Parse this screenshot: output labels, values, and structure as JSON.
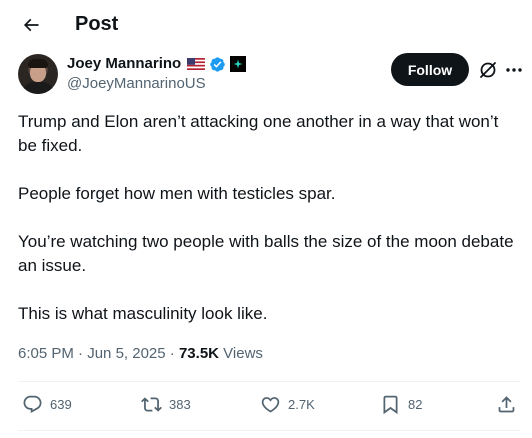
{
  "header": {
    "title": "Post"
  },
  "author": {
    "display_name": "Joey Mannarino",
    "handle": "@JoeyMannarinoUS",
    "flag": "us-flag",
    "verified": "blue-verified-badge",
    "affiliation": "affiliate-badge"
  },
  "follow": {
    "label": "Follow"
  },
  "tweet": {
    "paragraphs": [
      "Trump and Elon aren’t attacking one another in a way that won’t be fixed.",
      "People forget how men with testicles spar.",
      "You’re watching two people with balls the size of the moon debate an issue.",
      "This is what masculinity look like."
    ]
  },
  "meta": {
    "time": "6:05 PM",
    "sep1": "·",
    "date": "Jun 5, 2025",
    "sep2": "·",
    "views_count": "73.5K",
    "views_label": "Views"
  },
  "actions": {
    "replies": "639",
    "reposts": "383",
    "likes": "2.7K",
    "bookmarks": "82"
  },
  "colors": {
    "text": "#0f1419",
    "secondary": "#536471",
    "verified": "#1d9bf0",
    "follow_bg": "#0f1419",
    "divider": "#eff3f4"
  }
}
